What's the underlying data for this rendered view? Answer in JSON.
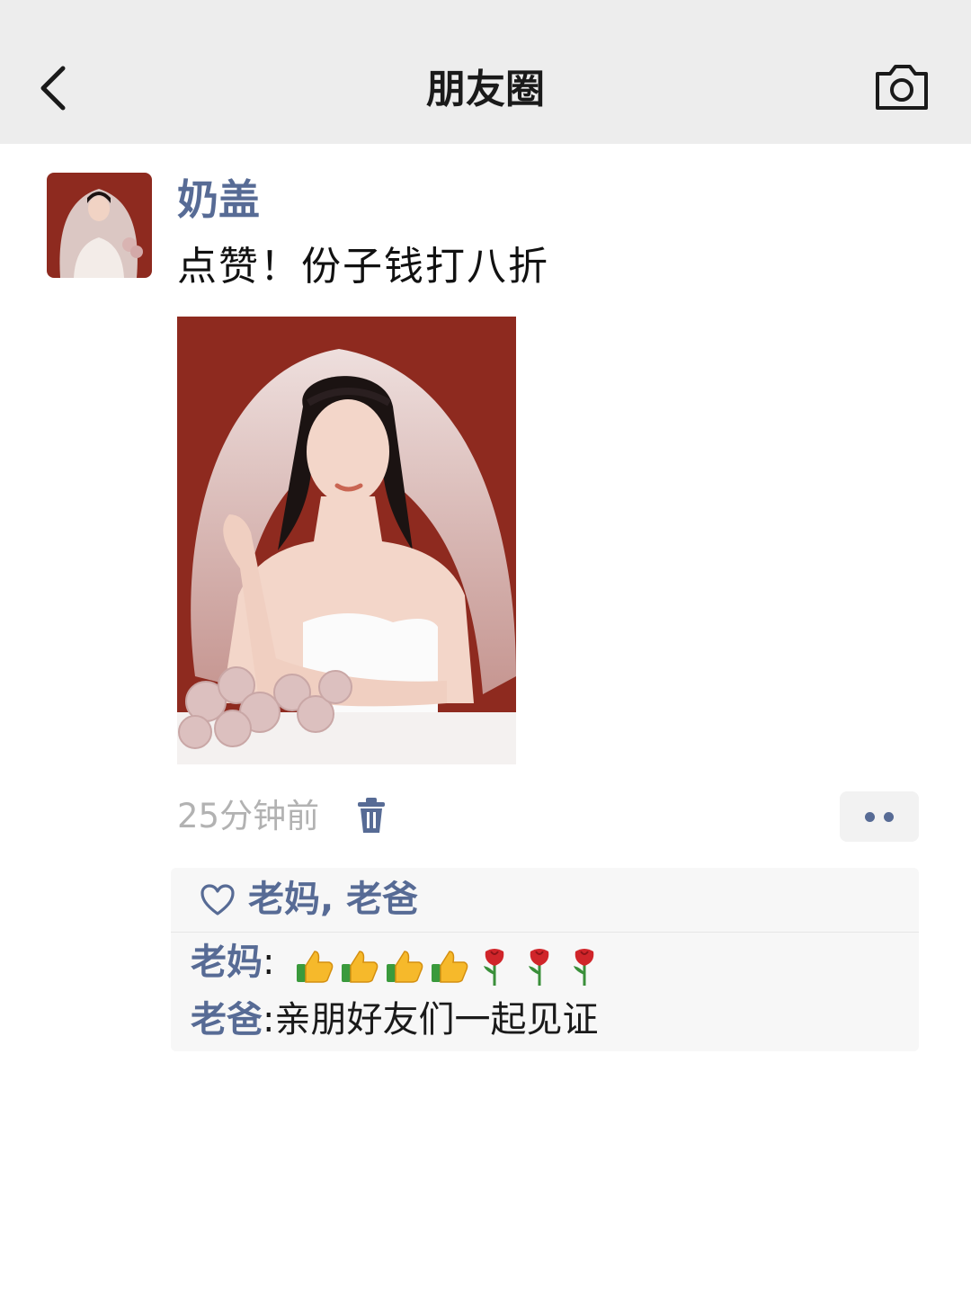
{
  "header": {
    "title": "朋友圈",
    "back_icon": "chevron-left-icon",
    "camera_icon": "camera-icon"
  },
  "post": {
    "username": "奶盖",
    "text": "点赞！份子钱打八折",
    "time": "25分钟前",
    "photo": "bride-portrait-veil-red-background"
  },
  "likes": {
    "names": "老妈, 老爸"
  },
  "comments": [
    {
      "author": "老妈",
      "separator": ":",
      "content": "",
      "emoji": [
        "thumbs-up",
        "thumbs-up",
        "thumbs-up",
        "thumbs-up",
        "rose",
        "rose",
        "rose"
      ]
    },
    {
      "author": "老爸",
      "separator": ":",
      "content": "亲朋好友们一起见证"
    }
  ],
  "colors": {
    "link": "#576b95",
    "header_bg": "#ededed",
    "photo_bg": "#8e2a1f",
    "meta": "#b2b2b2"
  }
}
